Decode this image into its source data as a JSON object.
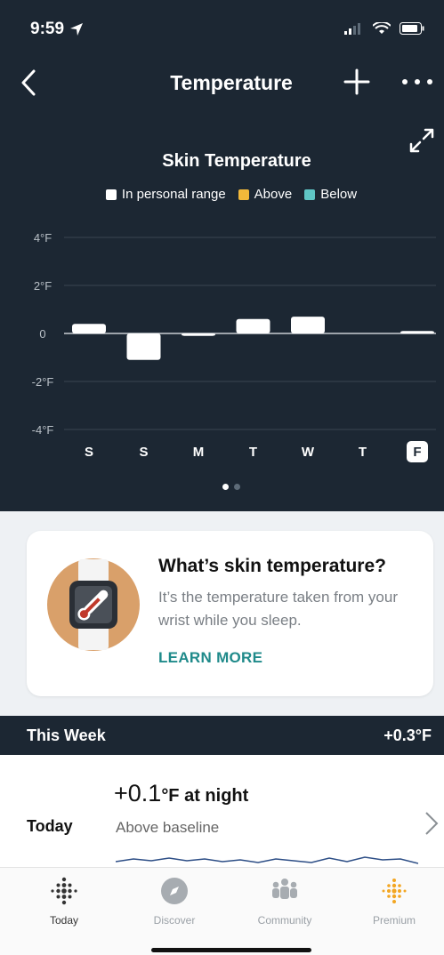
{
  "status": {
    "time": "9:59"
  },
  "nav": {
    "title": "Temperature",
    "back_icon": "chevron-left-icon",
    "add_icon": "plus-icon",
    "more_icon": "ellipsis-icon"
  },
  "colors": {
    "background": "#1c2733",
    "in_range": "#ffffff",
    "above": "#f3b93a",
    "below": "#5fc6c6",
    "accent": "#1f8a8a",
    "premium": "#f3a622"
  },
  "chart_data": {
    "type": "bar",
    "title": "Skin Temperature",
    "legend": [
      {
        "label": "In personal range",
        "color": "#ffffff"
      },
      {
        "label": "Above",
        "color": "#f3b93a"
      },
      {
        "label": "Below",
        "color": "#5fc6c6"
      }
    ],
    "y_ticks": [
      "4°F",
      "2°F",
      "0",
      "-2°F",
      "-4°F"
    ],
    "ylim": [
      -4,
      4
    ],
    "categories": [
      "S",
      "S",
      "M",
      "T",
      "W",
      "T",
      "F"
    ],
    "values": [
      0.4,
      -1.1,
      -0.1,
      0.6,
      0.7,
      null,
      0.1
    ],
    "highlighted_category_index": 6,
    "grid": true
  },
  "pager": {
    "pages": 2,
    "current": 1
  },
  "info_card": {
    "question": "What’s skin temperature?",
    "description": "It’s the temperature taken from your wrist while you sleep.",
    "link": "LEARN MORE",
    "illustration": "watch-thermometer-icon"
  },
  "week": {
    "label": "This Week",
    "value": "+0.3°F"
  },
  "today": {
    "day": "Today",
    "value": "+0.1",
    "unit": "°F at night",
    "subtitle": "Above baseline",
    "chevron_icon": "chevron-right-icon"
  },
  "tabs": [
    {
      "label": "Today",
      "icon": "fitbit-dots-icon",
      "active": true
    },
    {
      "label": "Discover",
      "icon": "compass-icon",
      "active": false
    },
    {
      "label": "Community",
      "icon": "community-icon",
      "active": false
    },
    {
      "label": "Premium",
      "icon": "premium-dots-icon",
      "active": false
    }
  ]
}
